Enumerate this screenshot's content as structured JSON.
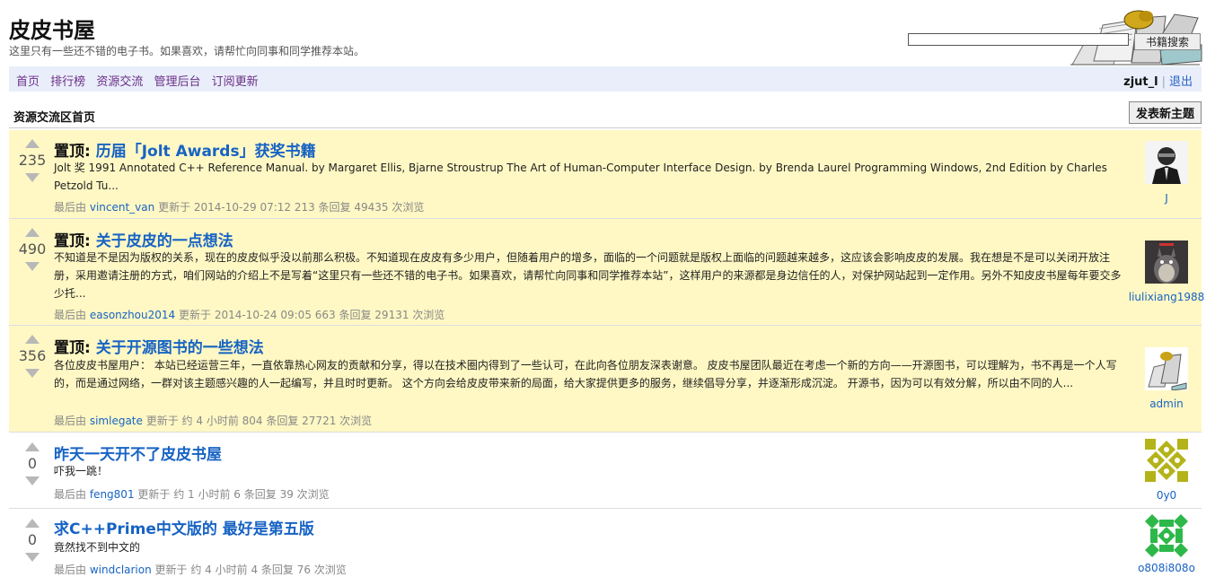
{
  "site": {
    "title": "皮皮书屋",
    "description": "这里只有一些还不错的电子书。如果喜欢，请帮忙向同事和同学推荐本站。"
  },
  "search": {
    "button_label": "书籍搜索",
    "value": ""
  },
  "nav": {
    "links": [
      "首页",
      "排行榜",
      "资源交流",
      "管理后台",
      "订阅更新"
    ],
    "username": "zjut_l",
    "separator": "|",
    "logout": "退出"
  },
  "section": {
    "title": "资源交流区首页",
    "new_topic_label": "发表新主题"
  },
  "colors": {
    "pinned_bg": "#fff8c4",
    "link": "#1763c4",
    "nav_bg": "#e9eefa"
  },
  "topics": [
    {
      "prefix": "置顶: ",
      "title": "历届「Jolt Awards」获奖书籍",
      "score": "235",
      "excerpt": "Jolt 奖 1991 Annotated C++ Reference Manual. by Margaret Ellis, Bjarne Stroustrup The Art of Human-Computer Interface Design. by Brenda Laurel Programming Windows, 2nd Edition by Charles Petzold Tu...",
      "meta_pre": "最后由",
      "last_by": "vincent_van",
      "meta_post": "更新于 2014-10-29 07:12 213 条回复 49435 次浏览",
      "author": "J",
      "avatar": "portrait-avatar"
    },
    {
      "prefix": "置顶: ",
      "title": "关于皮皮的一点想法",
      "score": "490",
      "excerpt": "不知道是不是因为版权的关系，现在的皮皮似乎没以前那么积极。不知道现在皮皮有多少用户，但随着用户的增多，面临的一个问题就是版权上面临的问题越来越多，这应该会影响皮皮的发展。我在想是不是可以关闭开放注册，采用邀请注册的方式，咱们网站的介绍上不是写着“这里只有一些还不错的电子书。如果喜欢，请帮忙向同事和同学推荐本站”，这样用户的来源都是身边信任的人，对保护网站起到一定作用。另外不知皮皮书屋每年要交多少托...",
      "meta_pre": "最后由",
      "last_by": "easonzhou2014",
      "meta_post": "更新于 2014-10-24 09:05 663 条回复 29131 次浏览",
      "author": "liulixiang1988",
      "avatar": "totoro-avatar"
    },
    {
      "prefix": "置顶: ",
      "title": "关于开源图书的一些想法",
      "score": "356",
      "excerpt": "各位皮皮书屋用户： 本站已经运营三年，一直依靠热心网友的贡献和分享，得以在技术圈内得到了一些认可，在此向各位朋友深表谢意。 皮皮书屋团队最近在考虑一个新的方向——开源图书，可以理解为，书不再是一个人写的，而是通过网络，一群对该主题感兴趣的人一起编写，并且时时更新。 这个方向会给皮皮带来新的局面，给大家提供更多的服务，继续倡导分享，并逐渐形成沉淀。 开源书，因为可以有效分解，所以由不同的人...",
      "meta_pre": "最后由",
      "last_by": "simlegate",
      "meta_post": "更新于 约 4 小时前 804 条回复 27721 次浏览",
      "author": "admin",
      "avatar": "books-avatar"
    },
    {
      "prefix": "",
      "title": "昨天一天开不了皮皮书屋",
      "score": "0",
      "excerpt": "吓我一跳！",
      "meta_pre": "最后由",
      "last_by": "feng801",
      "meta_post": "更新于 约 1 小时前 6 条回复 39 次浏览",
      "author": "0y0",
      "avatar": "identicon-avatar"
    },
    {
      "prefix": "",
      "title": "求C++Prime中文版的 最好是第五版",
      "score": "0",
      "excerpt": "竟然找不到中文的",
      "meta_pre": "最后由",
      "last_by": "windclarion",
      "meta_post": "更新于 约 4 小时前 4 条回复 76 次浏览",
      "author": "o808i808o",
      "avatar": "identicon-avatar"
    }
  ]
}
